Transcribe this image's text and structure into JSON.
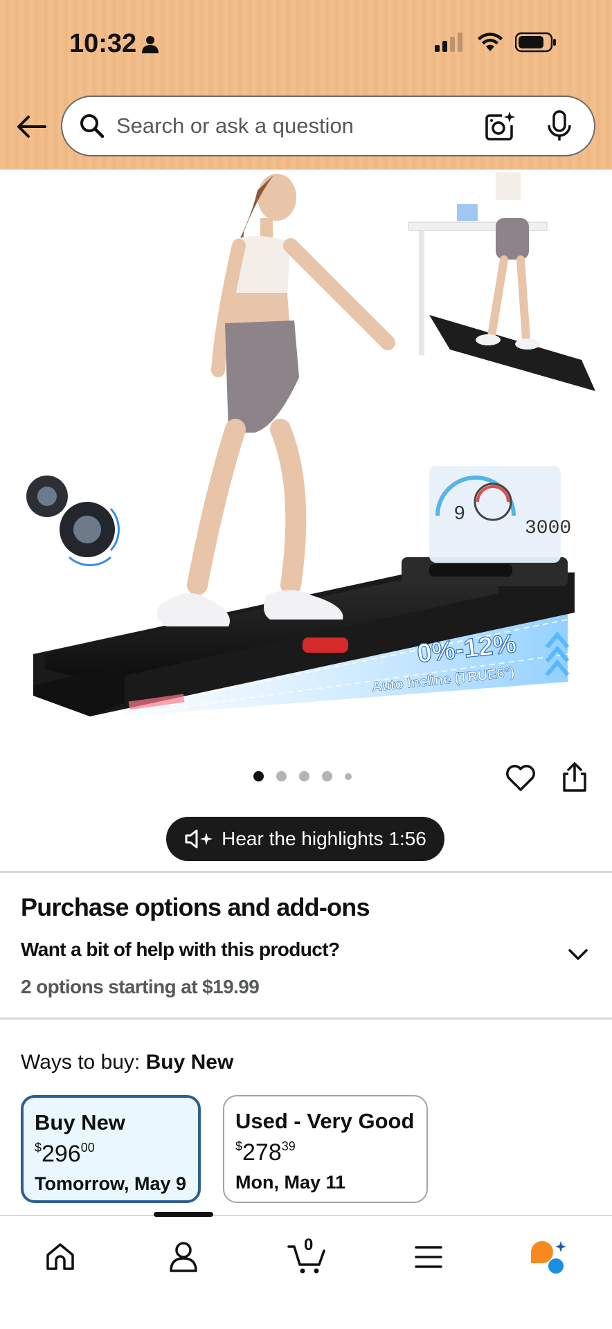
{
  "status_bar": {
    "time": "10:32"
  },
  "search": {
    "placeholder": "Search or ask a question"
  },
  "product_image": {
    "incline_text": "0%-12%",
    "incline_sub": "Auto Incline (TRUE6°)",
    "console_left": "9",
    "console_right": "3000"
  },
  "carousel": {
    "count": 5,
    "active_index": 0
  },
  "highlights": {
    "label": "Hear the highlights 1:56"
  },
  "purchase": {
    "title": "Purchase options and add-ons",
    "subtitle": "Want a bit of help with this product?",
    "options": "2 options starting at $19.99"
  },
  "ways_to_buy": {
    "label": "Ways to buy:",
    "selected": "Buy New",
    "cards": [
      {
        "title": "Buy New",
        "currency": "$",
        "price_whole": "296",
        "price_fraction": "00",
        "delivery": "Tomorrow, May 9"
      },
      {
        "title": "Used - Very Good",
        "currency": "$",
        "price_whole": "278",
        "price_fraction": "39",
        "delivery": "Mon, May 11"
      }
    ]
  },
  "bottom_nav": {
    "cart_count": "0",
    "active_item": "account"
  },
  "colors": {
    "header_bg": "#f2be8b",
    "selected_card_border": "#2d5f91",
    "selected_card_bg": "#eaf7fe",
    "rufus_orange": "#f68a1f",
    "rufus_blue": "#1a8fe3"
  }
}
